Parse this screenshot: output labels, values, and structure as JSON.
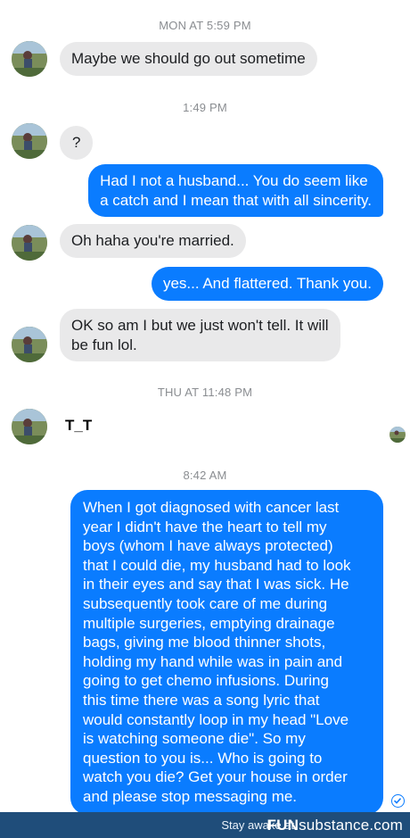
{
  "timestamps": {
    "t1": "MON AT 5:59 PM",
    "t2": "1:49 PM",
    "t3": "THU AT 11:48 PM",
    "t4": "8:42 AM"
  },
  "messages": {
    "m1": "Maybe we should go out sometime",
    "m2": "?",
    "m3": "Had I not a husband... You do seem like\na catch and I mean that with all sincerity.",
    "m4": "Oh haha you're married.",
    "m5": "yes... And flattered. Thank you.",
    "m6": "OK so am I but we just won't tell. It will\nbe fun lol.",
    "m7": "T_T",
    "m8": "When I got diagnosed with cancer last\nyear I didn't have the heart to tell my\nboys (whom I have always protected)\nthat I could die, my husband had to look\nin their eyes and say that I was sick. He\nsubsequently took care of me during\nmultiple surgeries, emptying drainage\nbags, giving me blood thinner shots,\nholding my hand while was in pain and\ngoing to get chemo infusions. During\nthis time there was a song lyric that\nwould constantly loop in my head \"Love\nis watching someone die\". So my\nquestion to you is... Who is going to\nwatch you die? Get your house in order\nand please stop messaging me."
  },
  "footer": {
    "stay_awake": "Stay awake at",
    "brand_a": "FUN",
    "brand_b": "substance",
    "brand_c": ".com"
  },
  "colors": {
    "outgoing_bubble": "#0a7cff",
    "incoming_bubble": "#e9e9ea",
    "timestamp": "#8a8d91",
    "footer_bg": "#1f4d7a"
  },
  "icons": [
    "avatar",
    "seen-avatar",
    "delivered-check-icon"
  ]
}
